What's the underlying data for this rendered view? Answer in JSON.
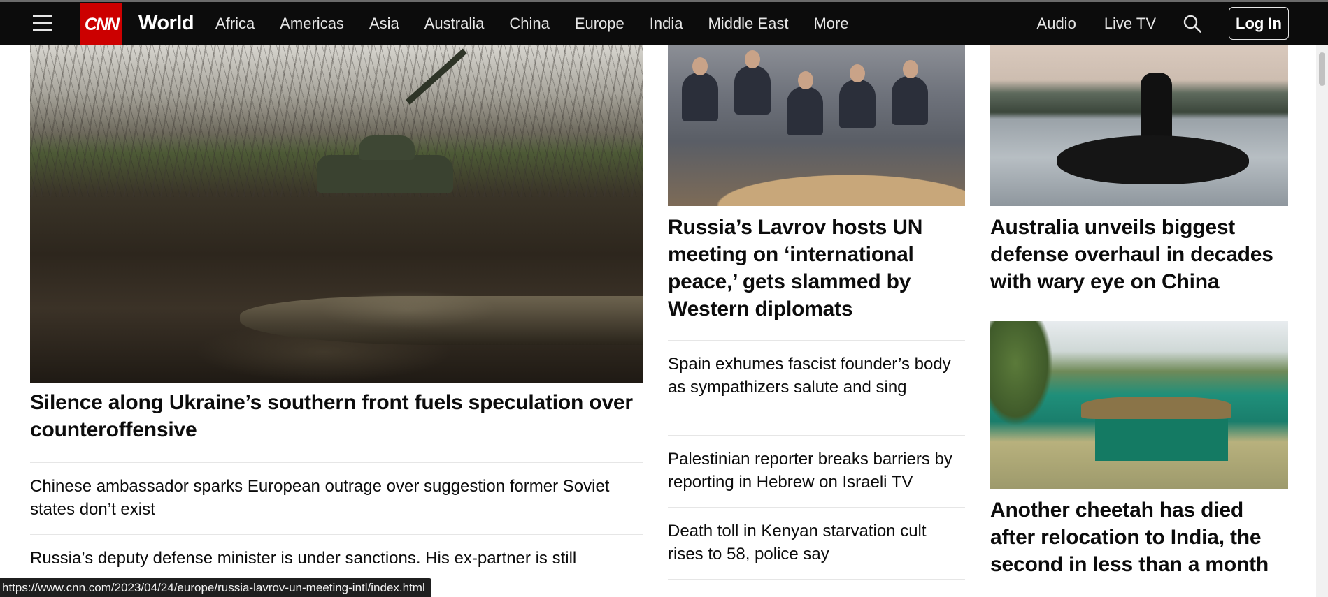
{
  "nav": {
    "logo": "CNN",
    "section": "World",
    "links": [
      "Africa",
      "Americas",
      "Asia",
      "Australia",
      "China",
      "Europe",
      "India",
      "Middle East",
      "More"
    ],
    "audio": "Audio",
    "live_tv": "Live TV",
    "login": "Log In"
  },
  "lead": {
    "headline": "Silence along Ukraine’s southern front fuels speculation over counteroffensive"
  },
  "left_stories": [
    "Chinese ambassador sparks European outrage over suggestion former Soviet states don’t exist",
    "Russia’s deputy defense minister is under sanctions. His ex-partner is still"
  ],
  "middle": {
    "headline": "Russia’s Lavrov hosts UN meeting on ‘international peace,’ gets slammed by Western diplomats",
    "stories": [
      "Spain exhumes fascist founder’s body as sympathizers salute and sing",
      "Palestinian reporter breaks barriers by reporting in Hebrew on Israeli TV",
      "Death toll in Kenyan starvation cult rises to 58, police say"
    ]
  },
  "right": {
    "headline_top": "Australia unveils biggest defense overhaul in decades with wary eye on China",
    "headline_bottom": "Another cheetah has died after relocation to India, the second in less than a month"
  },
  "status_url": "https://www.cnn.com/2023/04/24/europe/russia-lavrov-un-meeting-intl/index.html",
  "colors": {
    "nav_bg": "#0c0c0c",
    "brand_red": "#cc0000",
    "text": "#0c0c0c",
    "divider": "#e6e6e6"
  }
}
